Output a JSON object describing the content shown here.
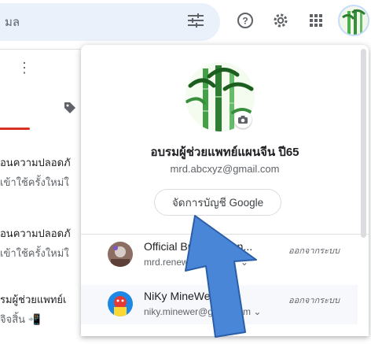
{
  "header": {
    "search_text": "มล",
    "icons": [
      "tune-icon",
      "help-icon",
      "settings-icon",
      "apps-icon",
      "account-avatar"
    ]
  },
  "mail_list": {
    "rows": [
      {
        "line1": "อนความปลอดภั",
        "line2": "เข้าใช้ครั้งใหม่ใ"
      },
      {
        "line1": "อนความปลอดภั",
        "line2": "เข้าใช้ครั้งใหม่ใ"
      },
      {
        "line1": "รมผู้ช่วยแพทย์เ",
        "line2": "จิจสิ้น "
      }
    ]
  },
  "account_panel": {
    "name": "อบรมผู้ช่วยแพทย์แผนจีน ปี65",
    "email": "mrd.abcxyz@gmail.com",
    "manage_button": "จัดการบัญชี Google",
    "accounts": [
      {
        "name": "Official Bu",
        "name_tail": "San...",
        "email": "mrd.renew@",
        "signout": "ออกจากระบบ"
      },
      {
        "name": "NiKy MineWer",
        "email": "niky.minewer@gmail.com",
        "signout": "ออกจากระบบ"
      }
    ]
  },
  "colors": {
    "accent_blue": "#4a86d8",
    "arrow_border": "#2b5ea7",
    "search_bg": "#eaf1fb",
    "inbox_red": "#d93025"
  }
}
